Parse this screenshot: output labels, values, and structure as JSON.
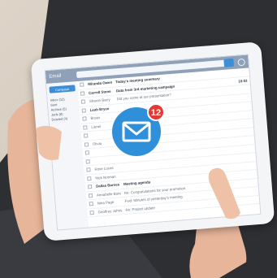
{
  "email_app": {
    "title": "Email",
    "compose_label": "Compose",
    "folders": [
      "Inbox (12)",
      "Sent",
      "Archive (5)",
      "Junk (8)",
      "Deleted (4)"
    ],
    "rows": [
      {
        "sender": "Miranda Owens",
        "subject": "Today's meeting summary",
        "time": "",
        "unread": true
      },
      {
        "sender": "Carroll Stone",
        "subject": "Data from 3rd marketing campaign",
        "time": "10:03",
        "unread": true
      },
      {
        "sender": "Sharon Barry",
        "subject": "Did you come at our presentation?",
        "time": "",
        "unread": false
      },
      {
        "sender": "Leah Bryce",
        "subject": "",
        "time": "",
        "unread": true
      },
      {
        "sender": "Bryan",
        "subject": "",
        "time": "",
        "unread": false
      },
      {
        "sender": "Lionel",
        "subject": "",
        "time": "",
        "unread": false
      },
      {
        "sender": "",
        "subject": "",
        "time": "",
        "unread": false
      },
      {
        "sender": "Olivia",
        "subject": "",
        "time": "",
        "unread": false
      },
      {
        "sender": "",
        "subject": "",
        "time": "",
        "unread": false
      },
      {
        "sender": "",
        "subject": "",
        "time": "",
        "unread": false
      },
      {
        "sender": "Rose Lucas",
        "subject": "",
        "time": "",
        "unread": false
      },
      {
        "sender": "Nick Norman",
        "subject": "",
        "time": "",
        "unread": false
      },
      {
        "sender": "Dallas Barnes",
        "subject": "Meeting agenda",
        "time": "",
        "unread": true
      },
      {
        "sender": "Annabelle Bond",
        "subject": "Re: Congratulations for your promotion",
        "time": "",
        "unread": false
      },
      {
        "sender": "Nina Page",
        "subject": "Fwd: Minutes of yesterday's meeting",
        "time": "",
        "unread": false
      },
      {
        "sender": "Geoffrey Johnson",
        "subject": "Re: Project update",
        "time": "",
        "unread": false
      }
    ]
  },
  "badge": {
    "count": "12",
    "icon": "envelope-icon",
    "circle_color": "#2f8fd8",
    "count_color": "#e53935"
  },
  "colors": {
    "sweater": "#2e2f33",
    "skin": "#e7b69a",
    "background": "#c9bfb3"
  }
}
